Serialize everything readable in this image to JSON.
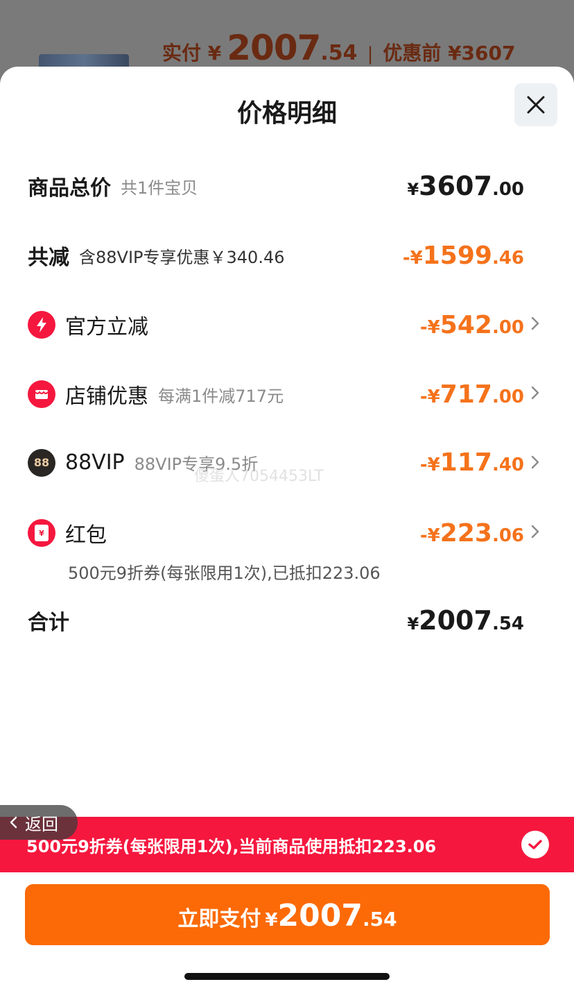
{
  "background": {
    "actual_label": "实付 ¥",
    "actual_int": "2007",
    "actual_dec": ".54",
    "separator": "|",
    "original_label": "优惠前 ¥3607"
  },
  "sheet": {
    "title": "价格明细",
    "close_icon": "close-icon"
  },
  "rows": {
    "total": {
      "label": "商品总价",
      "sub": "共1件宝贝",
      "yen": "¥",
      "int": "3607",
      "dec": ".00"
    },
    "reduce": {
      "label": "共减",
      "sub": "含88VIP专享优惠￥340.46",
      "yen": "-¥",
      "int": "1599",
      "dec": ".46"
    },
    "official": {
      "label": "官方立减",
      "yen": "-¥",
      "int": "542",
      "dec": ".00",
      "icon": "lightning-icon"
    },
    "shop": {
      "label": "店铺优惠",
      "sub": "每满1件减717元",
      "yen": "-¥",
      "int": "717",
      "dec": ".00",
      "icon": "shop-icon"
    },
    "vip": {
      "label": "88VIP",
      "sub": "88VIP专享9.5折",
      "badge": "88",
      "yen": "-¥",
      "int": "117",
      "dec": ".40",
      "icon": "vip-icon"
    },
    "redpacket": {
      "label": "红包",
      "yen": "-¥",
      "int": "223",
      "dec": ".06",
      "icon": "red-packet-icon",
      "glyph": "¥",
      "note": "500元9折券(每张限用1次),已抵扣223.06"
    },
    "sum": {
      "label": "合计",
      "yen": "¥",
      "int": "2007",
      "dec": ".54"
    }
  },
  "watermark": "傻蛋人7054453LT",
  "back": {
    "label": "返回"
  },
  "coupon_bar": {
    "text": "500元9折券(每张限用1次),当前商品使用抵扣223.06"
  },
  "pay": {
    "label": "立即支付",
    "yen": "¥",
    "int": "2007",
    "dec": ".54"
  },
  "colors": {
    "accent_orange": "#fb6a07",
    "discount_orange": "#f5721b",
    "coupon_red": "#f5173e"
  }
}
